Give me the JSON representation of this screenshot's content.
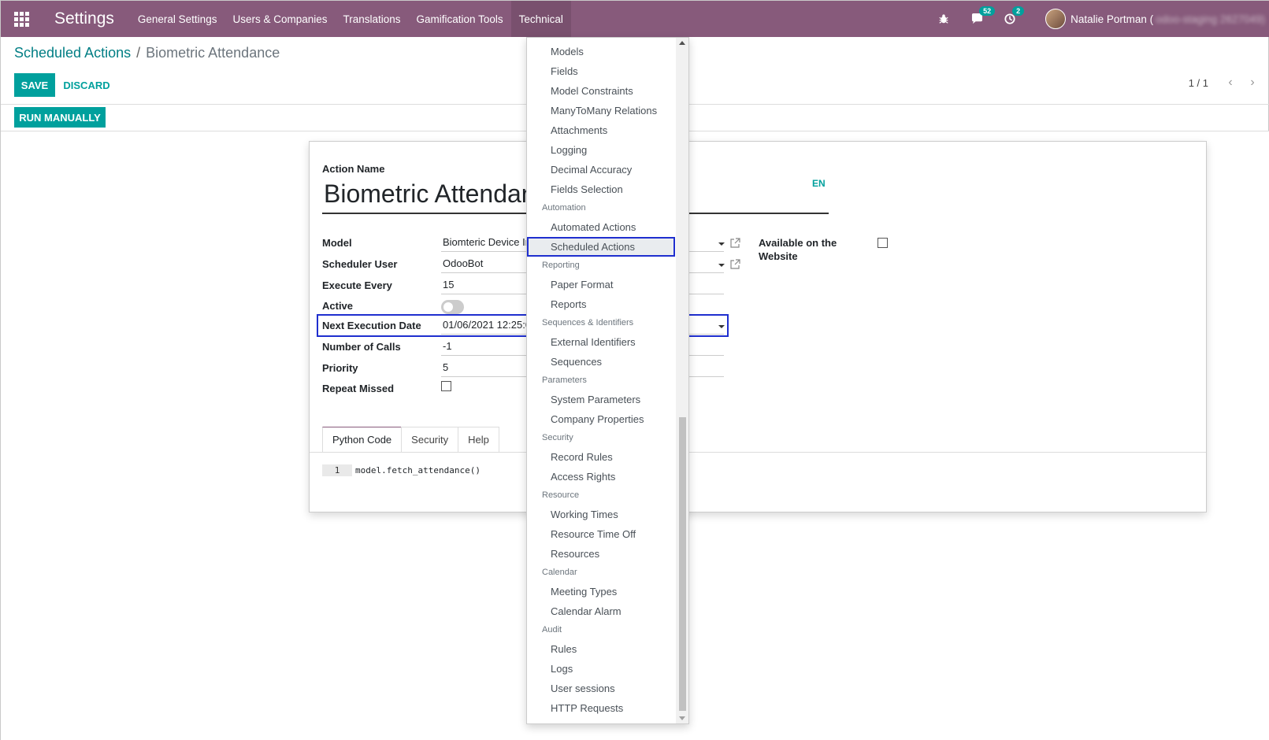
{
  "navbar": {
    "brand": "Settings",
    "menu": [
      "General Settings",
      "Users & Companies",
      "Translations",
      "Gamification Tools",
      "Technical"
    ],
    "messages_count": "52",
    "activities_count": "2",
    "user_name": "Natalie Portman (",
    "user_db": "odoo-staging 2627049)"
  },
  "breadcrumb": {
    "parent": "Scheduled Actions",
    "separator": "/",
    "current": "Biometric Attendance"
  },
  "buttons": {
    "save": "SAVE",
    "discard": "DISCARD",
    "run": "RUN MANUALLY"
  },
  "pager": {
    "value": "1 / 1",
    "prev": "‹",
    "next": "›"
  },
  "form": {
    "action_name_label": "Action Name",
    "action_name": "Biometric Attendance",
    "lang": "EN",
    "model_label": "Model",
    "model": "Biomteric Device Info",
    "scheduler_user_label": "Scheduler User",
    "scheduler_user": "OdooBot",
    "execute_every_label": "Execute Every",
    "execute_every": "15",
    "active_label": "Active",
    "active": false,
    "next_exec_label": "Next Execution Date",
    "next_exec": "01/06/2021 12:25:00",
    "calls_label": "Number of Calls",
    "calls": "-1",
    "priority_label": "Priority",
    "priority": "5",
    "repeat_missed_label": "Repeat Missed",
    "available_label_1": "Available on the",
    "available_label_2": "Website",
    "tabs": [
      "Python Code",
      "Security",
      "Help"
    ],
    "code_line_no": "1",
    "code": "model.fetch_attendance()"
  },
  "dropdown": {
    "items_top": [
      "Models",
      "Fields",
      "Model Constraints",
      "ManyToMany Relations",
      "Attachments",
      "Logging",
      "Decimal Accuracy",
      "Fields Selection"
    ],
    "h_automation": "Automation",
    "automation": [
      "Automated Actions",
      "Scheduled Actions"
    ],
    "h_reporting": "Reporting",
    "reporting": [
      "Paper Format",
      "Reports"
    ],
    "h_sequences": "Sequences & Identifiers",
    "sequences": [
      "External Identifiers",
      "Sequences"
    ],
    "h_parameters": "Parameters",
    "parameters": [
      "System Parameters",
      "Company Properties"
    ],
    "h_security": "Security",
    "security": [
      "Record Rules",
      "Access Rights"
    ],
    "h_resource": "Resource",
    "resource": [
      "Working Times",
      "Resource Time Off",
      "Resources"
    ],
    "h_calendar": "Calendar",
    "calendar": [
      "Meeting Types",
      "Calendar Alarm"
    ],
    "h_audit": "Audit",
    "audit": [
      "Rules",
      "Logs",
      "User sessions",
      "HTTP Requests"
    ]
  }
}
